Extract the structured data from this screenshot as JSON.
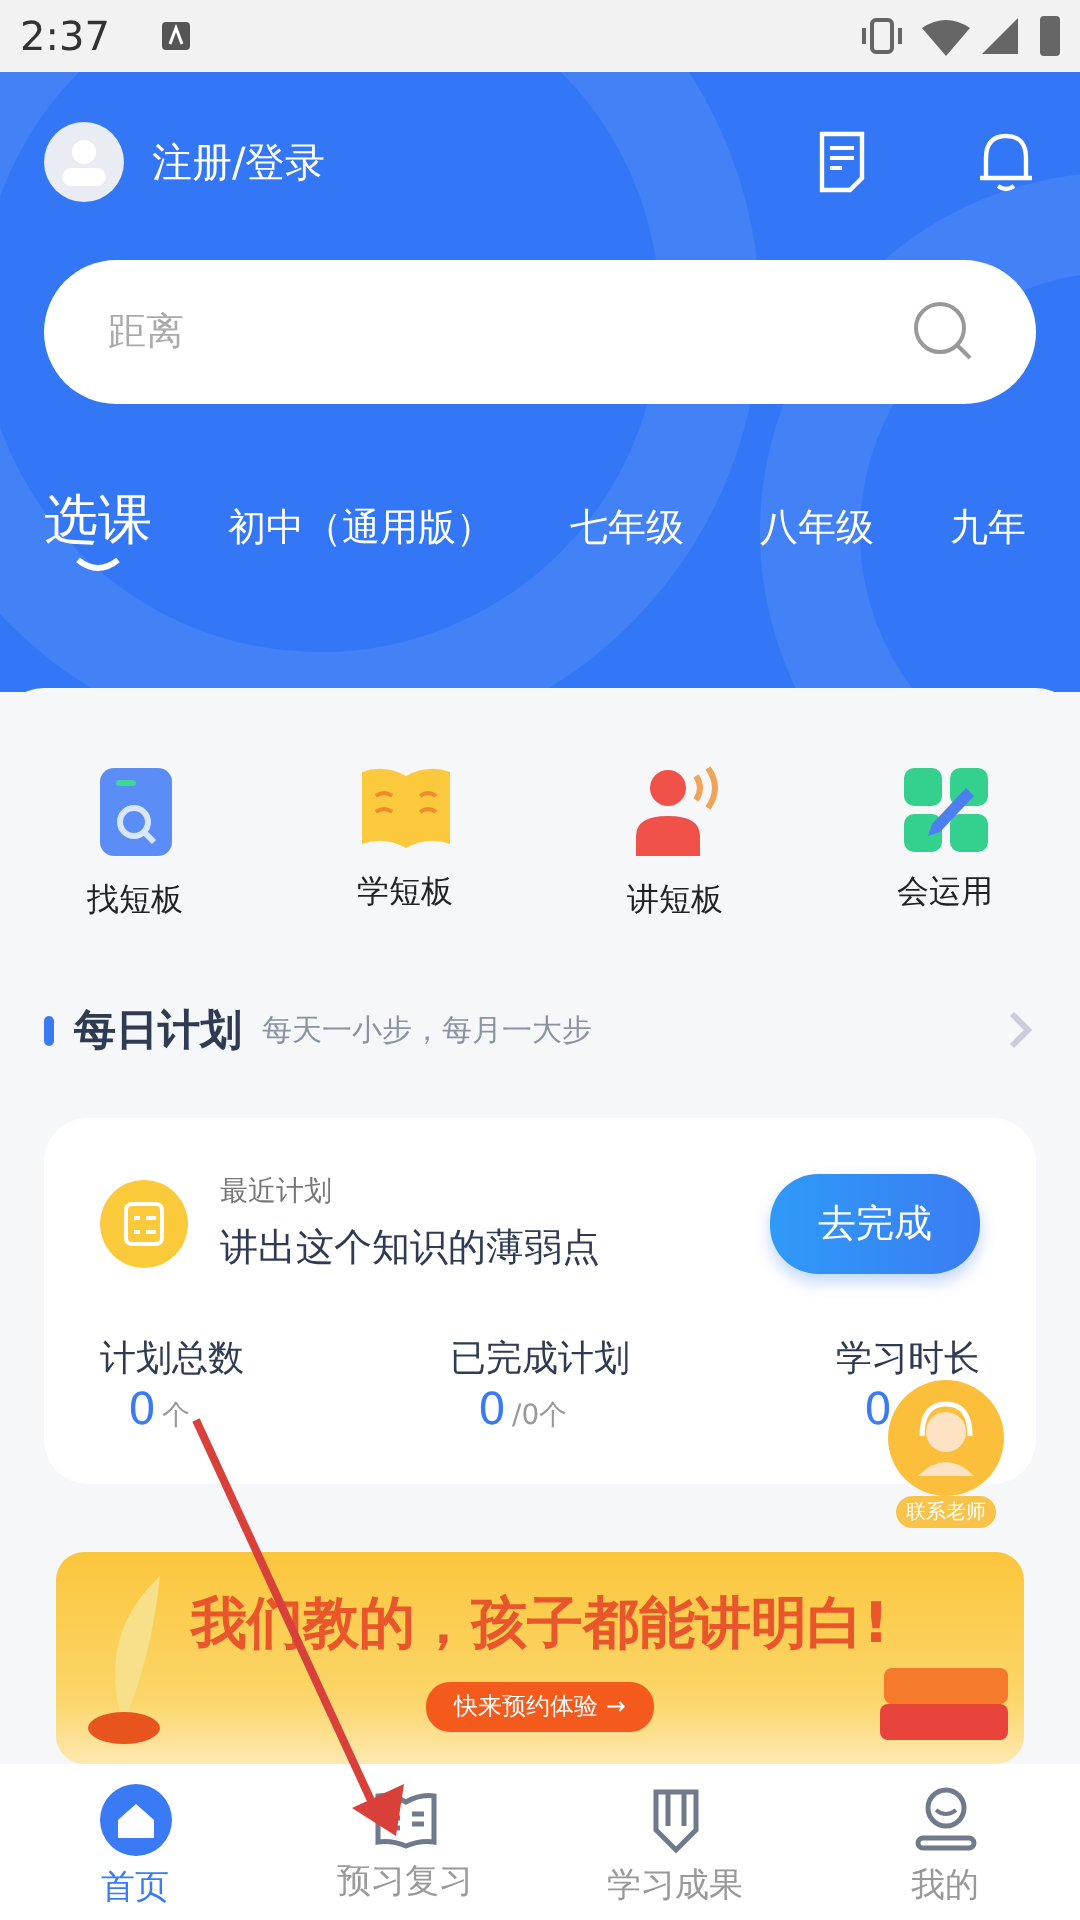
{
  "status_bar": {
    "time": "2:37"
  },
  "header": {
    "login": "注册/登录",
    "search": {
      "placeholder": "距离"
    },
    "tabs": [
      {
        "label": "选课",
        "selected": true
      },
      {
        "label": "初中（通用版）",
        "selected": false
      },
      {
        "label": "七年级",
        "selected": false
      },
      {
        "label": "八年级",
        "selected": false
      },
      {
        "label": "九年",
        "selected": false
      }
    ]
  },
  "shortcuts": [
    {
      "label": "找短板",
      "kind": "find"
    },
    {
      "label": "学短板",
      "kind": "learn"
    },
    {
      "label": "讲短板",
      "kind": "speak"
    },
    {
      "label": "会运用",
      "kind": "apply"
    }
  ],
  "daily_plan": {
    "title": "每日计划",
    "subtitle": "每天一小步，每月一大步",
    "card": {
      "caption": "最近计划",
      "plan": "讲出这个知识的薄弱点",
      "button": "去完成",
      "stats": [
        {
          "label": "计划总数",
          "value": "0",
          "unit": "个"
        },
        {
          "label": "已完成计划",
          "value": "0",
          "unit": "/0个"
        },
        {
          "label": "学习时长",
          "value": "0"
        }
      ]
    }
  },
  "contact_button": "联系老师",
  "banner": {
    "headline": "我们教的，孩子都能讲明白!",
    "button": "快来预约体验 →"
  },
  "bottom_nav": [
    {
      "label": "首页",
      "selected": true,
      "kind": "home"
    },
    {
      "label": "预习复习",
      "selected": false,
      "kind": "book"
    },
    {
      "label": "学习成果",
      "selected": false,
      "kind": "pencil"
    },
    {
      "label": "我的",
      "selected": false,
      "kind": "person"
    }
  ]
}
